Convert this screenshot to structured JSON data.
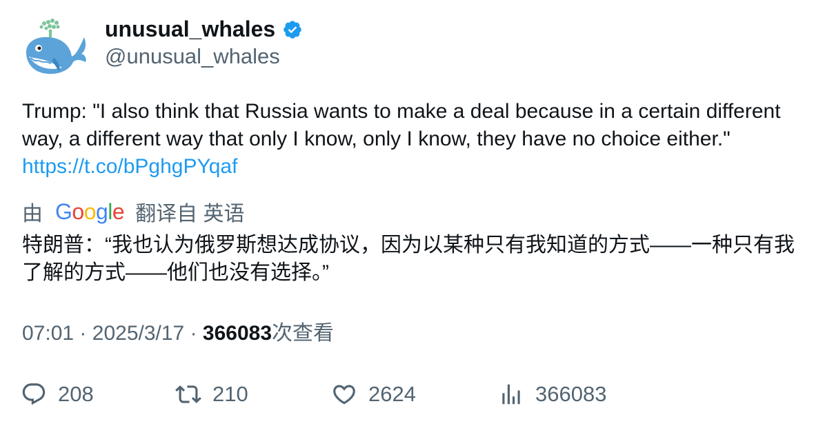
{
  "author": {
    "display_name": "unusual_whales",
    "handle": "@unusual_whales",
    "verified": true,
    "avatar_icon": "whale-avatar-icon",
    "verified_color": "#1d9bf0"
  },
  "tweet": {
    "text": "Trump: \"I also think that Russia wants to make a deal because in a certain different way, a different way that only I know, only I know, they have no choice either.\" ",
    "link": "https://t.co/bPghgPYqaf",
    "link_color": "#1d9bf0"
  },
  "translation": {
    "prefix": "由",
    "provider": "Google",
    "suffix": "翻译自 英语",
    "text": "特朗普：“我也认为俄罗斯想达成协议，因为以某种只有我知道的方式——一种只有我了解的方式——他们也没有选择。”"
  },
  "meta": {
    "time": "07:01",
    "separator": "·",
    "date": "2025/3/17",
    "views_count": "366083",
    "views_label": "次查看"
  },
  "actions": {
    "reply": {
      "icon": "reply-icon",
      "count": "208"
    },
    "retweet": {
      "icon": "retweet-icon",
      "count": "210"
    },
    "like": {
      "icon": "heart-icon",
      "count": "2624"
    },
    "views": {
      "icon": "analytics-icon",
      "count": "366083"
    }
  },
  "colors": {
    "text_primary": "#0f1419",
    "text_secondary": "#536471",
    "google_blue": "#4285f4",
    "google_red": "#ea4335",
    "google_yellow": "#fbbc05",
    "google_green": "#34a853"
  }
}
